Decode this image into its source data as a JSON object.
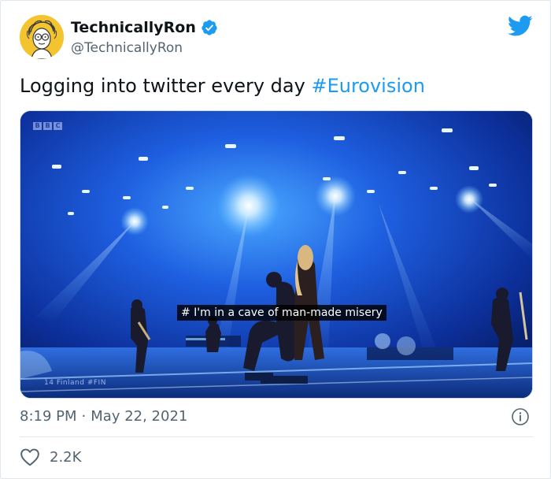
{
  "author": {
    "display_name": "TechnicallyRon",
    "handle": "@TechnicallyRon",
    "verified": true
  },
  "tweet": {
    "text_before": "Logging into twitter every day ",
    "hashtag": "#Eurovision"
  },
  "media": {
    "caption": "# I'm in a cave of man-made misery",
    "broadcaster_logo": [
      "B",
      "B",
      "C"
    ],
    "scoreboard_text": "14 Finland #FIN"
  },
  "meta": {
    "time": "8:19 PM",
    "separator": "·",
    "date": "May 22, 2021"
  },
  "engagement": {
    "likes": "2.2K"
  },
  "colors": {
    "accent": "#1d9bf0",
    "text": "#0f1419",
    "secondary_text": "#536471",
    "divider": "#e1e8ed"
  },
  "icons": [
    "verified-badge-icon",
    "twitter-bird-icon",
    "info-icon",
    "heart-icon"
  ]
}
